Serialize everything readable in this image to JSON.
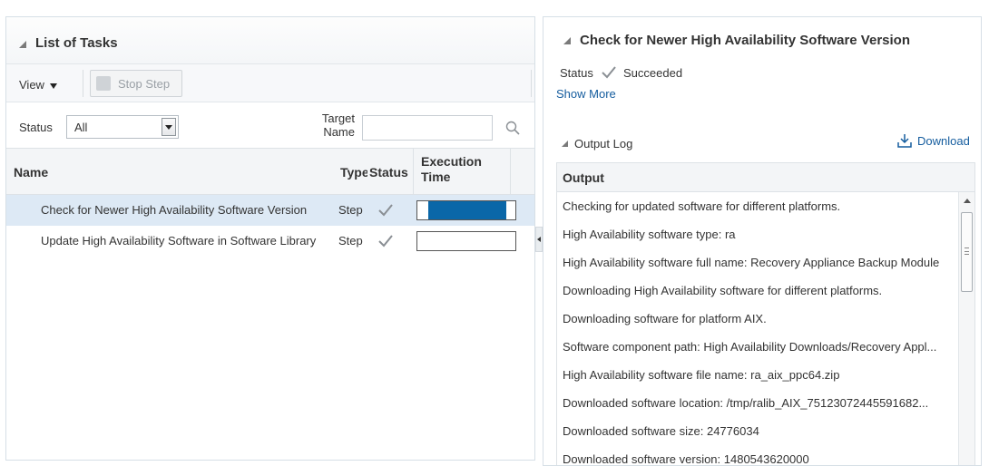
{
  "left_panel": {
    "title": "List of Tasks",
    "toolbar": {
      "view_label": "View",
      "stop_step_label": "Stop Step"
    },
    "filters": {
      "status_label": "Status",
      "status_value": "All",
      "target_name_label": "Target\nName",
      "target_name_value": ""
    },
    "columns": {
      "name": "Name",
      "type": "Type",
      "status": "Status",
      "execution_time": "Execution\nTime"
    },
    "tasks": [
      {
        "name": "Check for Newer High Availability Software Version",
        "type": "Step",
        "status": "succeeded",
        "execution_progress": 0.9,
        "selected": true
      },
      {
        "name": "Update High Availability Software in Software Library",
        "type": "Step",
        "status": "succeeded",
        "execution_progress": 0,
        "selected": false
      }
    ]
  },
  "right_panel": {
    "title": "Check for Newer High Availability Software Version",
    "status_label": "Status",
    "status_value": "Succeeded",
    "show_more_label": "Show More",
    "output_log_title": "Output Log",
    "download_label": "Download",
    "output_column": "Output",
    "output_lines": [
      "Checking for updated software for different platforms.",
      "High Availability software type: ra",
      "High Availability software full name: Recovery Appliance Backup Module",
      "Downloading High Availability software for different platforms.",
      "Downloading software for platform AIX.",
      "Software component path: High Availability Downloads/Recovery Appl...",
      "High Availability software file name: ra_aix_ppc64.zip",
      "Downloaded software location: /tmp/ralib_AIX_75123072445591682...",
      "Downloaded software size: 24776034",
      "Downloaded software version: 1480543620000"
    ]
  },
  "colors": {
    "accent": "#0a67a8",
    "link": "#145c9e",
    "selected_row": "#dde9f5",
    "success_check": "#8a8f94"
  },
  "icons": {
    "disclosure": "triangle-down-icon",
    "search": "search-icon",
    "check": "check-icon",
    "download": "download-icon",
    "stop": "stop-icon"
  }
}
